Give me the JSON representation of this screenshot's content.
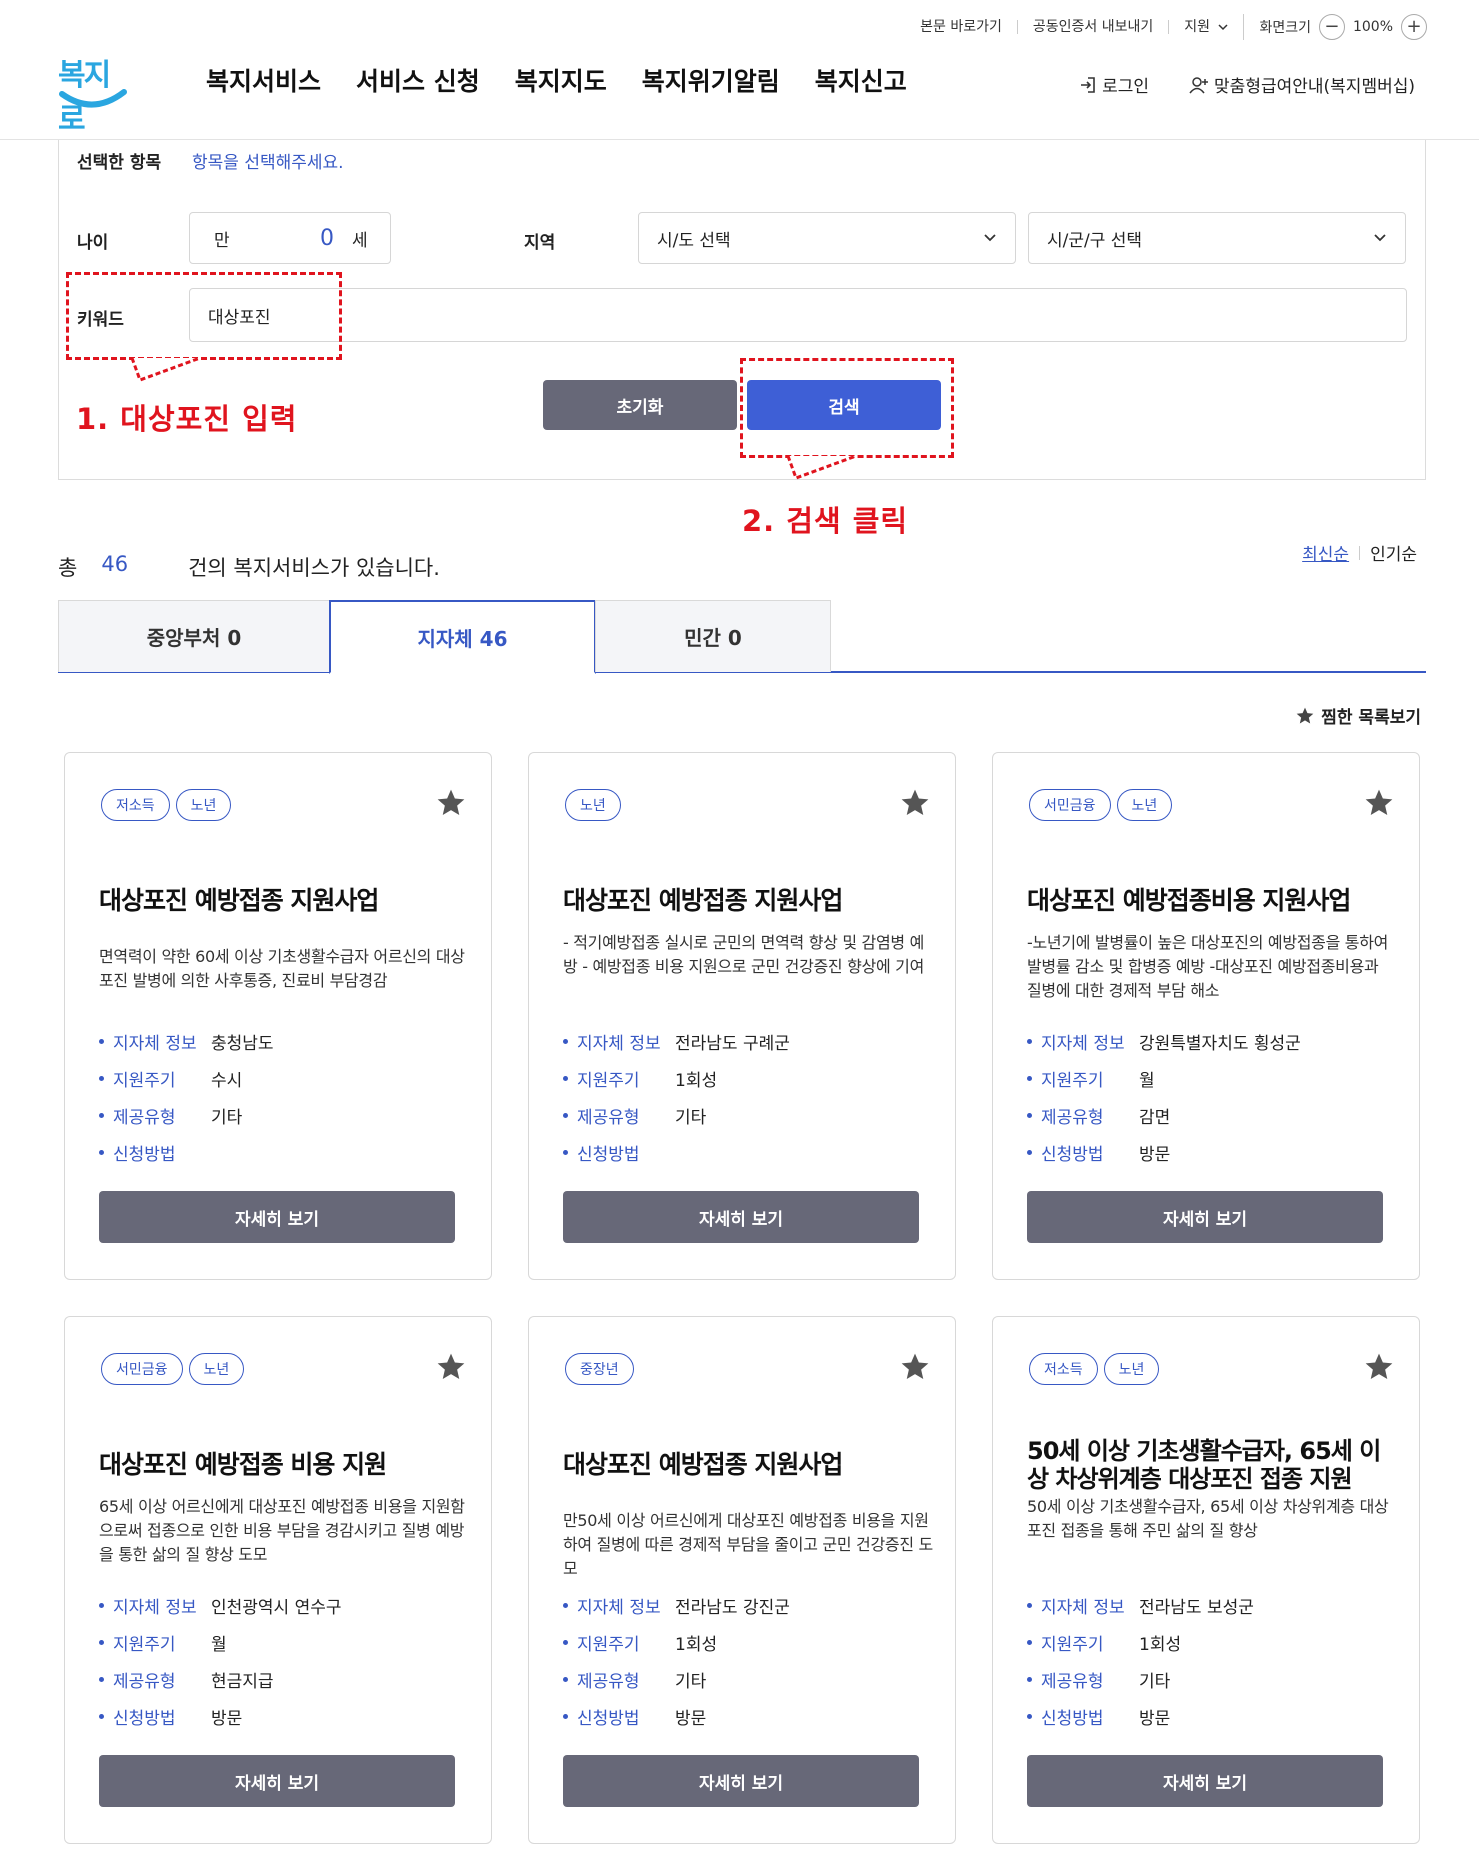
{
  "header": {
    "utility_links": [
      "본문 바로가기",
      "공동인증서 내보내기",
      "지원"
    ],
    "zoom_label": "화면크기",
    "zoom_value": "100%",
    "logo_text": "복지로",
    "nav": [
      "복지서비스",
      "서비스 신청",
      "복지지도",
      "복지위기알림",
      "복지신고"
    ],
    "login": "로그인",
    "membership": "맞춤형급여안내(복지멤버십)"
  },
  "search": {
    "selected_label": "선택한 항목",
    "selected_hint": "항목을 선택해주세요.",
    "age_label": "나이",
    "age_prefix": "만",
    "age_value": "0",
    "age_suffix": "세",
    "region_label": "지역",
    "sido_placeholder": "시/도 선택",
    "sigungu_placeholder": "시/군/구 선택",
    "keyword_label": "키워드",
    "keyword_value": "대상포진",
    "reset_button": "초기화",
    "search_button": "검색"
  },
  "annotations": {
    "step1": "1. 대상포진 입력",
    "step2": "2. 검색 클릭"
  },
  "results": {
    "total_prefix": "총",
    "total_count": "46",
    "total_suffix": "건의 복지서비스가 있습니다.",
    "sort_latest": "최신순",
    "sort_popular": "인기순",
    "favorites_link": "찜한 목록보기",
    "tabs": [
      "중앙부처 0",
      "지자체 46",
      "민간 0"
    ],
    "info_keys": [
      "지자체 정보",
      "지원주기",
      "제공유형",
      "신청방법"
    ],
    "detail_button": "자세히 보기",
    "cards": [
      {
        "tags": [
          "저소득",
          "노년"
        ],
        "title": "대상포진 예방접종 지원사업",
        "desc": "면역력이 약한 60세 이상 기초생활수급자 어르신의 대상포진 발병에 의한 사후통증, 진료비 부담경감",
        "values": [
          "충청남도",
          "수시",
          "기타",
          ""
        ]
      },
      {
        "tags": [
          "노년"
        ],
        "title": "대상포진 예방접종 지원사업",
        "desc": "- 적기예방접종 실시로 군민의 면역력 향상 및 감염병 예방 - 예방접종 비용 지원으로 군민 건강증진 향상에 기여",
        "values": [
          "전라남도 구례군",
          "1회성",
          "기타",
          ""
        ]
      },
      {
        "tags": [
          "서민금융",
          "노년"
        ],
        "title": "대상포진 예방접종비용 지원사업",
        "desc": "-노년기에 발병률이 높은 대상포진의 예방접종을 통하여 발병률 감소 및 합병증 예방 -대상포진 예방접종비용과 질병에 대한 경제적 부담 해소",
        "values": [
          "강원특별자치도 횡성군",
          "월",
          "감면",
          "방문"
        ]
      },
      {
        "tags": [
          "서민금융",
          "노년"
        ],
        "title": "대상포진 예방접종 비용 지원",
        "desc": "65세 이상 어르신에게 대상포진 예방접종 비용을 지원함으로써 접종으로 인한 비용 부담을 경감시키고 질병 예방을 통한 삶의 질 향상 도모",
        "values": [
          "인천광역시 연수구",
          "월",
          "현금지급",
          "방문"
        ]
      },
      {
        "tags": [
          "중장년"
        ],
        "title": "대상포진 예방접종 지원사업",
        "desc": "만50세 이상 어르신에게 대상포진 예방접종 비용을 지원하여 질병에 따른 경제적 부담을 줄이고 군민 건강증진 도모",
        "values": [
          "전라남도 강진군",
          "1회성",
          "기타",
          "방문"
        ]
      },
      {
        "tags": [
          "저소득",
          "노년"
        ],
        "title": "50세 이상 기초생활수급자, 65세 이상 차상위계층 대상포진 접종 지원",
        "desc": "50세 이상 기초생활수급자, 65세 이상 차상위계층 대상포진 접종을 통해 주민 삶의 질 향상",
        "values": [
          "전라남도 보성군",
          "1회성",
          "기타",
          "방문"
        ]
      }
    ]
  },
  "colors": {
    "accent": "#3758c4",
    "search_button": "#3e5fd6",
    "reset_button": "#676878",
    "annotation": "#e0141e"
  }
}
